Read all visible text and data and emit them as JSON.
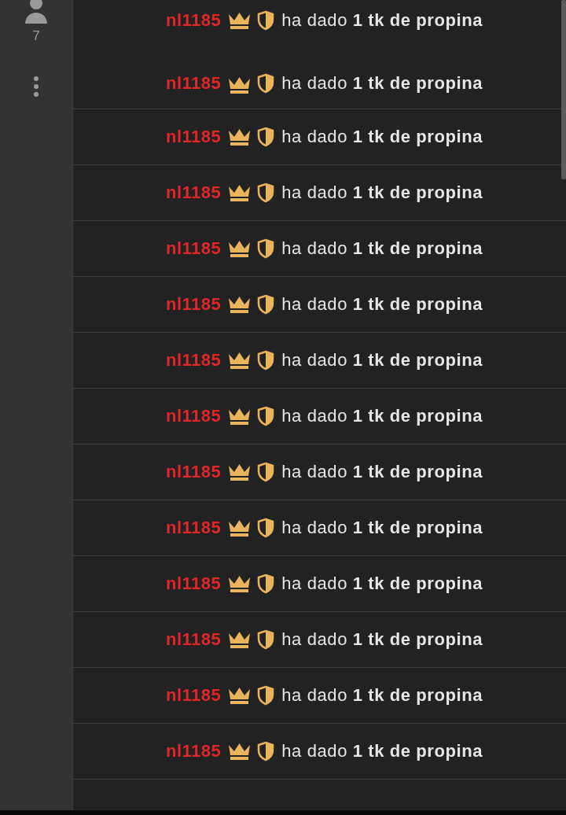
{
  "sidebar": {
    "viewer_count": "7"
  },
  "messages": [
    {
      "user": "nl1185",
      "text": "ha dado **1 tk de propina**"
    },
    {
      "user": "nl1185",
      "text": "ha dado **1 tk de propina**"
    },
    {
      "user": "nl1185",
      "text": "ha dado **1 tk de propina**"
    },
    {
      "user": "nl1185",
      "text": "ha dado **1 tk de propina**"
    },
    {
      "user": "nl1185",
      "text": "ha dado **1 tk de propina**"
    },
    {
      "user": "nl1185",
      "text": "ha dado **1 tk de propina**"
    },
    {
      "user": "nl1185",
      "text": "ha dado **1 tk de propina**"
    },
    {
      "user": "nl1185",
      "text": "ha dado **1 tk de propina**"
    },
    {
      "user": "nl1185",
      "text": "ha dado **1 tk de propina**"
    },
    {
      "user": "nl1185",
      "text": "ha dado **1 tk de propina**"
    },
    {
      "user": "nl1185",
      "text": "ha dado **1 tk de propina**"
    },
    {
      "user": "nl1185",
      "text": "ha dado **1 tk de propina**"
    },
    {
      "user": "nl1185",
      "text": "ha dado **1 tk de propina**"
    },
    {
      "user": "nl1185",
      "text": "ha dado **1 tk de propina**"
    }
  ]
}
